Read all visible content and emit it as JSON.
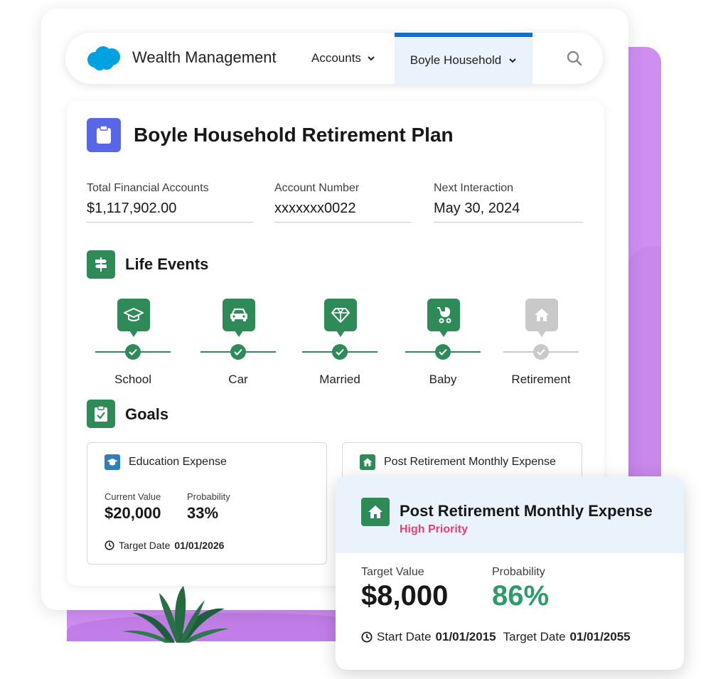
{
  "app": {
    "name": "Wealth Management"
  },
  "nav": {
    "accounts_label": "Accounts",
    "active_tab_label": "Boyle Household"
  },
  "page": {
    "title": "Boyle Household Retirement Plan",
    "fields": [
      {
        "label": "Total Financial Accounts",
        "value": "$1,117,902.00"
      },
      {
        "label": "Account Number",
        "value": "xxxxxxx0022"
      },
      {
        "label": "Next Interaction",
        "value": "May 30, 2024"
      }
    ]
  },
  "life_events": {
    "title": "Life Events",
    "items": [
      {
        "label": "School",
        "icon": "graduation-cap-icon",
        "completed": true
      },
      {
        "label": "Car",
        "icon": "car-icon",
        "completed": true
      },
      {
        "label": "Married",
        "icon": "diamond-icon",
        "completed": true
      },
      {
        "label": "Baby",
        "icon": "stroller-icon",
        "completed": true
      },
      {
        "label": "Retirement",
        "icon": "home-icon",
        "completed": false
      }
    ]
  },
  "goals": {
    "title": "Goals",
    "cards": [
      {
        "title": "Education Expense",
        "current_value_label": "Current Value",
        "current_value": "$20,000",
        "probability_label": "Probability",
        "probability": "33%",
        "target_date_label": "Target Date",
        "target_date": "01/01/2026"
      },
      {
        "title": "Post Retirement Monthly Expense"
      }
    ]
  },
  "detail_card": {
    "title": "Post Retirement Monthly Expense",
    "priority": "High Priority",
    "target_value_label": "Target Value",
    "target_value": "$8,000",
    "probability_label": "Probability",
    "probability": "86%",
    "start_date_label": "Start Date",
    "start_date": "01/01/2015",
    "target_date_label": "Target Date",
    "target_date": "01/01/2055"
  },
  "colors": {
    "brand_blue": "#00a1e0",
    "active_tab_border": "#0b70d2",
    "title_icon_bg": "#5867e8",
    "success_green": "#2e8b57",
    "inactive_gray": "#c9c9c9",
    "priority_pink": "#e3426f",
    "probability_green": "#2e9c6a",
    "purple_backdrop": "#cf8ef2"
  }
}
